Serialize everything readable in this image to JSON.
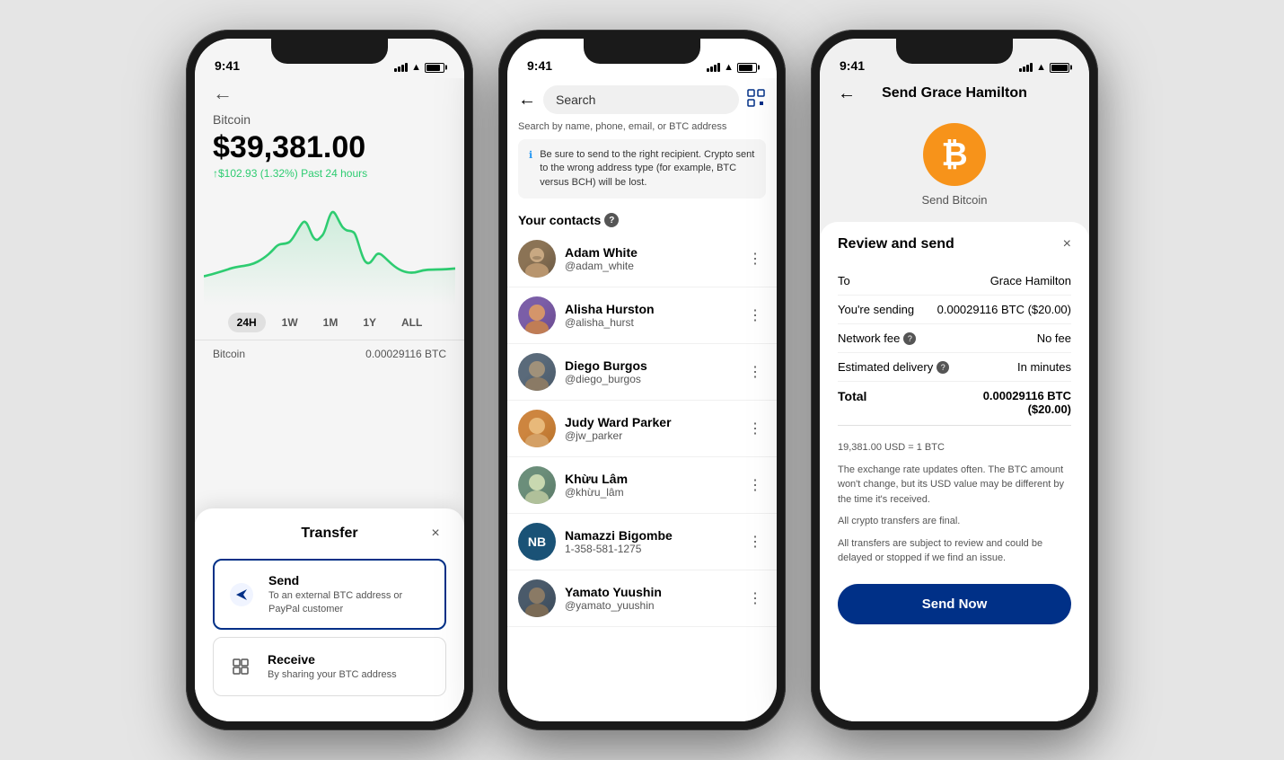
{
  "phone1": {
    "status": {
      "time": "9:41"
    },
    "back_arrow": "←",
    "coin_label": "Bitcoin",
    "price": "$39,381.00",
    "change": "↑$102.93 (1.32%) Past 24 hours",
    "time_filters": [
      "24H",
      "1W",
      "1M",
      "1Y",
      "ALL"
    ],
    "active_filter": "24H",
    "btc_row_left": "Bitcoin",
    "btc_row_right": "0.00029116 BTC",
    "transfer_sheet": {
      "title": "Transfer",
      "close": "×",
      "options": [
        {
          "id": "send",
          "title": "Send",
          "description": "To an external BTC address or PayPal customer",
          "selected": true
        },
        {
          "id": "receive",
          "title": "Receive",
          "description": "By sharing your BTC address",
          "selected": false
        }
      ]
    }
  },
  "phone2": {
    "status": {
      "time": "9:41"
    },
    "search_placeholder": "Search",
    "search_hint": "Search by name, phone, email, or BTC address",
    "info_message": "Be sure to send to the right recipient. Crypto sent to the wrong address type (for example, BTC versus BCH) will be lost.",
    "contacts_label": "Your contacts",
    "contacts": [
      {
        "id": "adam",
        "name": "Adam White",
        "handle": "@adam_white",
        "avatar_type": "image",
        "avatar_color": "#8B7355"
      },
      {
        "id": "alisha",
        "name": "Alisha Hurston",
        "handle": "@alisha_hurst",
        "avatar_type": "image",
        "avatar_color": "#7B5EA7"
      },
      {
        "id": "diego",
        "name": "Diego Burgos",
        "handle": "@diego_burgos",
        "avatar_type": "image",
        "avatar_color": "#5A6A7A"
      },
      {
        "id": "judy",
        "name": "Judy Ward Parker",
        "handle": "@jw_parker",
        "avatar_type": "image",
        "avatar_color": "#CD853F"
      },
      {
        "id": "khuu",
        "name": "Khừu Lâm",
        "handle": "@khừu_lâm",
        "avatar_type": "image",
        "avatar_color": "#6B8E7A"
      },
      {
        "id": "namazzi",
        "name": "Namazzi Bigombe",
        "handle": "1-358-581-1275",
        "avatar_type": "initials",
        "initials": "NB",
        "avatar_color": "#1A5276"
      },
      {
        "id": "yamato",
        "name": "Yamato Yuushin",
        "handle": "@yamato_yuushin",
        "avatar_type": "image",
        "avatar_color": "#4A5A6A"
      }
    ]
  },
  "phone3": {
    "status": {
      "time": "9:41"
    },
    "back_arrow": "←",
    "header_title": "Send Grace Hamilton",
    "send_bitcoin_label": "Send Bitcoin",
    "review_sheet": {
      "title": "Review and send",
      "close": "×",
      "rows": [
        {
          "label": "To",
          "value": "Grace Hamilton",
          "has_help": false
        },
        {
          "label": "You're sending",
          "value": "0.00029116 BTC ($20.00)",
          "has_help": false
        },
        {
          "label": "Network fee",
          "value": "No fee",
          "has_help": true
        },
        {
          "label": "Estimated delivery",
          "value": "In minutes",
          "has_help": true
        },
        {
          "label": "Total",
          "value": "0.00029116 BTC\n($20.00)",
          "has_help": false,
          "is_total": true
        }
      ],
      "info_lines": [
        "19,381.00 USD = 1 BTC",
        "The exchange rate updates often. The BTC amount won't change, but its USD value may be different by the time it's received.",
        "All crypto transfers are final.",
        "All transfers are subject to review and could be delayed or stopped if we find an issue."
      ],
      "send_button_label": "Send Now"
    }
  }
}
